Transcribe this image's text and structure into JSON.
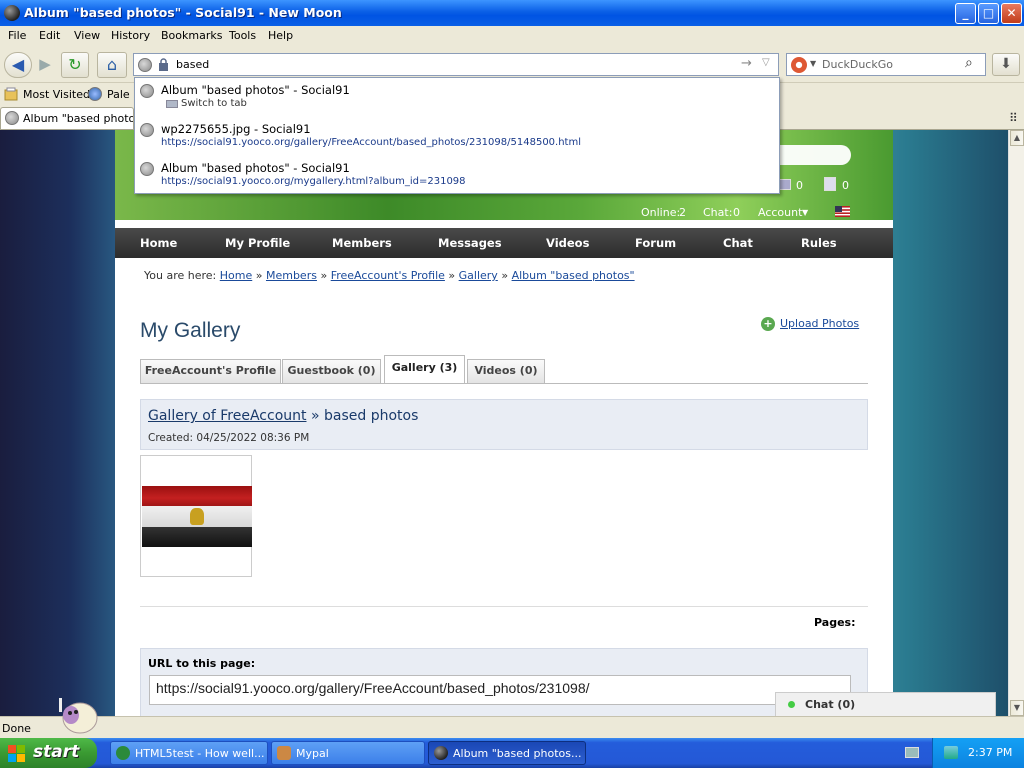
{
  "window": {
    "title": "Album \"based photos\" - Social91 - New Moon",
    "buttons": {
      "minimize": "_",
      "maximize": "□",
      "close": "✕"
    }
  },
  "menu": [
    "File",
    "Edit",
    "View",
    "History",
    "Bookmarks",
    "Tools",
    "Help"
  ],
  "toolbar": {
    "back": "◀",
    "forward": "▶",
    "reload": "↻",
    "home": "⌂",
    "url_value": "based",
    "go": "→",
    "dropdown": "▽",
    "search_placeholder": "DuckDuckGo",
    "search_icon": "⌕",
    "download": "⬇"
  },
  "bookmarks": {
    "items": [
      "Most Visited",
      "Pale M"
    ]
  },
  "tabs": [
    {
      "label": "Album \"based photos\" - ..."
    }
  ],
  "autocomplete": [
    {
      "title": "Album \"based photos\" - Social91",
      "action": "Switch to tab"
    },
    {
      "title": "wp2275655.jpg - Social91",
      "url": "https://social91.yooco.org/gallery/FreeAccount/based_photos/231098/5148500.html"
    },
    {
      "title": "Album \"based photos\" - Social91",
      "url": "https://social91.yooco.org/mygallery.html?album_id=231098"
    }
  ],
  "site": {
    "header_counts": {
      "notifications": "0",
      "requests": "0"
    },
    "stats": {
      "online_label": "Online:",
      "online_count": "2",
      "chat_label": "Chat:",
      "chat_count": "0",
      "account": "Account",
      "account_arrow": "▼"
    },
    "nav": [
      "Home",
      "My Profile",
      "Members",
      "Messages",
      "Videos",
      "Forum",
      "Chat",
      "Rules"
    ],
    "breadcrumb": {
      "prefix": "You are here:",
      "items": [
        "Home",
        "Members",
        "FreeAccount's Profile",
        "Gallery",
        "Album \"based photos\""
      ],
      "sep": "»"
    },
    "page_title": "My Gallery",
    "upload_label": "Upload Photos",
    "upload_icon": "+",
    "profile_tabs": [
      {
        "label": "FreeAccount's Profile",
        "active": false
      },
      {
        "label": "Guestbook (0)",
        "active": false
      },
      {
        "label": "Gallery (3)",
        "active": true
      },
      {
        "label": "Videos (0)",
        "active": false
      }
    ],
    "gallery": {
      "owner_link": "Gallery of FreeAccount",
      "separator": "»",
      "album_name": "based photos",
      "created": "Created: 04/25/2022 08:36 PM"
    },
    "pages_label": "Pages:",
    "url_section": {
      "label": "URL to this page:",
      "value": "https://social91.yooco.org/gallery/FreeAccount/based_photos/231098/"
    },
    "chat_widget": "Chat (0)"
  },
  "scrollbar": {
    "up": "▲",
    "down": "▼"
  },
  "status": "Done",
  "taskbar": {
    "start": "start",
    "items": [
      {
        "label": "HTML5test - How well...",
        "active": false
      },
      {
        "label": "Mypal",
        "active": false
      },
      {
        "label": "Album \"based photos...",
        "active": true
      }
    ],
    "clock": "2:37 PM"
  },
  "colors": {
    "title_bar": "#0a5fe6",
    "nav_bar": "#2c2c2c",
    "link": "#1a4a9a",
    "taskbar": "#245ddb",
    "start_button": "#3a9a32"
  }
}
